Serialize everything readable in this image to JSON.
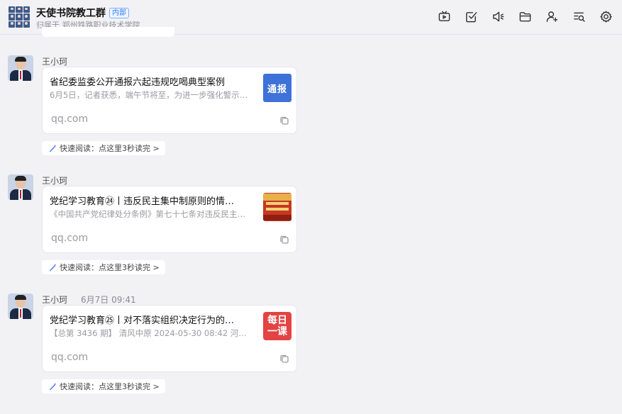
{
  "header": {
    "group_name": "天使书院教工群",
    "badge": "内部",
    "sub_label": "归属于",
    "sub_org": "郑州铁路职业技术学院"
  },
  "toolbar": [
    {
      "icon": "tv-icon"
    },
    {
      "icon": "checkbox-icon"
    },
    {
      "icon": "announcement-icon"
    },
    {
      "icon": "folder-icon"
    },
    {
      "icon": "add-member-icon"
    },
    {
      "icon": "search-history-icon"
    },
    {
      "icon": "settings-icon"
    }
  ],
  "messages": [
    {
      "sender": "王小珂",
      "time": "",
      "title": "省纪委监委公开通报六起违规吃喝典型案例",
      "desc": "6月5日，记者获悉，端午节将至，为进一步强化警示…",
      "source": "qq.com",
      "thumb_text": "通报",
      "quick_read": "快速阅读：点这里3秒读完 >"
    },
    {
      "sender": "王小珂",
      "time": "",
      "title": "党纪学习教育㉔丨违反民主集中制原则的情…",
      "desc": "《中国共产党纪律处分条例》第七十七条对违反民主…",
      "source": "qq.com",
      "thumb_text": "",
      "quick_read": "快速阅读：点这里3秒读完 >"
    },
    {
      "sender": "王小珂",
      "time": "6月7日 09:41",
      "title": "党纪学习教育㉕丨对不落实组织决定行为的…",
      "desc": "【总第 3436 期】 清风中原 2024-05-30 08:42 河南…",
      "source": "qq.com",
      "thumb_text_1": "每日",
      "thumb_text_2": "一课",
      "quick_read": "快速阅读：点这里3秒读完 >"
    }
  ],
  "colors": {
    "background": "#f2f2f5",
    "card": "#ffffff",
    "badge_blue": "#2f7bff",
    "thumb_blue": "#3f72d8",
    "thumb_red": "#e44343"
  }
}
